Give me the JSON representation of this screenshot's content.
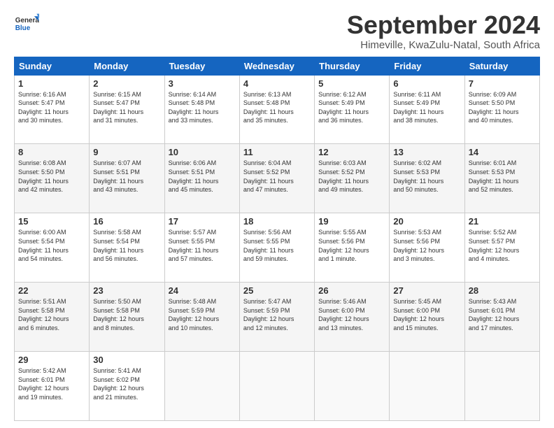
{
  "logo": {
    "general": "General",
    "blue": "Blue"
  },
  "header": {
    "title": "September 2024",
    "subtitle": "Himeville, KwaZulu-Natal, South Africa"
  },
  "weekdays": [
    "Sunday",
    "Monday",
    "Tuesday",
    "Wednesday",
    "Thursday",
    "Friday",
    "Saturday"
  ],
  "weeks": [
    [
      {
        "day": "1",
        "info": "Sunrise: 6:16 AM\nSunset: 5:47 PM\nDaylight: 11 hours\nand 30 minutes."
      },
      {
        "day": "2",
        "info": "Sunrise: 6:15 AM\nSunset: 5:47 PM\nDaylight: 11 hours\nand 31 minutes."
      },
      {
        "day": "3",
        "info": "Sunrise: 6:14 AM\nSunset: 5:48 PM\nDaylight: 11 hours\nand 33 minutes."
      },
      {
        "day": "4",
        "info": "Sunrise: 6:13 AM\nSunset: 5:48 PM\nDaylight: 11 hours\nand 35 minutes."
      },
      {
        "day": "5",
        "info": "Sunrise: 6:12 AM\nSunset: 5:49 PM\nDaylight: 11 hours\nand 36 minutes."
      },
      {
        "day": "6",
        "info": "Sunrise: 6:11 AM\nSunset: 5:49 PM\nDaylight: 11 hours\nand 38 minutes."
      },
      {
        "day": "7",
        "info": "Sunrise: 6:09 AM\nSunset: 5:50 PM\nDaylight: 11 hours\nand 40 minutes."
      }
    ],
    [
      {
        "day": "8",
        "info": "Sunrise: 6:08 AM\nSunset: 5:50 PM\nDaylight: 11 hours\nand 42 minutes."
      },
      {
        "day": "9",
        "info": "Sunrise: 6:07 AM\nSunset: 5:51 PM\nDaylight: 11 hours\nand 43 minutes."
      },
      {
        "day": "10",
        "info": "Sunrise: 6:06 AM\nSunset: 5:51 PM\nDaylight: 11 hours\nand 45 minutes."
      },
      {
        "day": "11",
        "info": "Sunrise: 6:04 AM\nSunset: 5:52 PM\nDaylight: 11 hours\nand 47 minutes."
      },
      {
        "day": "12",
        "info": "Sunrise: 6:03 AM\nSunset: 5:52 PM\nDaylight: 11 hours\nand 49 minutes."
      },
      {
        "day": "13",
        "info": "Sunrise: 6:02 AM\nSunset: 5:53 PM\nDaylight: 11 hours\nand 50 minutes."
      },
      {
        "day": "14",
        "info": "Sunrise: 6:01 AM\nSunset: 5:53 PM\nDaylight: 11 hours\nand 52 minutes."
      }
    ],
    [
      {
        "day": "15",
        "info": "Sunrise: 6:00 AM\nSunset: 5:54 PM\nDaylight: 11 hours\nand 54 minutes."
      },
      {
        "day": "16",
        "info": "Sunrise: 5:58 AM\nSunset: 5:54 PM\nDaylight: 11 hours\nand 56 minutes."
      },
      {
        "day": "17",
        "info": "Sunrise: 5:57 AM\nSunset: 5:55 PM\nDaylight: 11 hours\nand 57 minutes."
      },
      {
        "day": "18",
        "info": "Sunrise: 5:56 AM\nSunset: 5:55 PM\nDaylight: 11 hours\nand 59 minutes."
      },
      {
        "day": "19",
        "info": "Sunrise: 5:55 AM\nSunset: 5:56 PM\nDaylight: 12 hours\nand 1 minute."
      },
      {
        "day": "20",
        "info": "Sunrise: 5:53 AM\nSunset: 5:56 PM\nDaylight: 12 hours\nand 3 minutes."
      },
      {
        "day": "21",
        "info": "Sunrise: 5:52 AM\nSunset: 5:57 PM\nDaylight: 12 hours\nand 4 minutes."
      }
    ],
    [
      {
        "day": "22",
        "info": "Sunrise: 5:51 AM\nSunset: 5:58 PM\nDaylight: 12 hours\nand 6 minutes."
      },
      {
        "day": "23",
        "info": "Sunrise: 5:50 AM\nSunset: 5:58 PM\nDaylight: 12 hours\nand 8 minutes."
      },
      {
        "day": "24",
        "info": "Sunrise: 5:48 AM\nSunset: 5:59 PM\nDaylight: 12 hours\nand 10 minutes."
      },
      {
        "day": "25",
        "info": "Sunrise: 5:47 AM\nSunset: 5:59 PM\nDaylight: 12 hours\nand 12 minutes."
      },
      {
        "day": "26",
        "info": "Sunrise: 5:46 AM\nSunset: 6:00 PM\nDaylight: 12 hours\nand 13 minutes."
      },
      {
        "day": "27",
        "info": "Sunrise: 5:45 AM\nSunset: 6:00 PM\nDaylight: 12 hours\nand 15 minutes."
      },
      {
        "day": "28",
        "info": "Sunrise: 5:43 AM\nSunset: 6:01 PM\nDaylight: 12 hours\nand 17 minutes."
      }
    ],
    [
      {
        "day": "29",
        "info": "Sunrise: 5:42 AM\nSunset: 6:01 PM\nDaylight: 12 hours\nand 19 minutes."
      },
      {
        "day": "30",
        "info": "Sunrise: 5:41 AM\nSunset: 6:02 PM\nDaylight: 12 hours\nand 21 minutes."
      },
      {
        "day": "",
        "info": ""
      },
      {
        "day": "",
        "info": ""
      },
      {
        "day": "",
        "info": ""
      },
      {
        "day": "",
        "info": ""
      },
      {
        "day": "",
        "info": ""
      }
    ]
  ]
}
